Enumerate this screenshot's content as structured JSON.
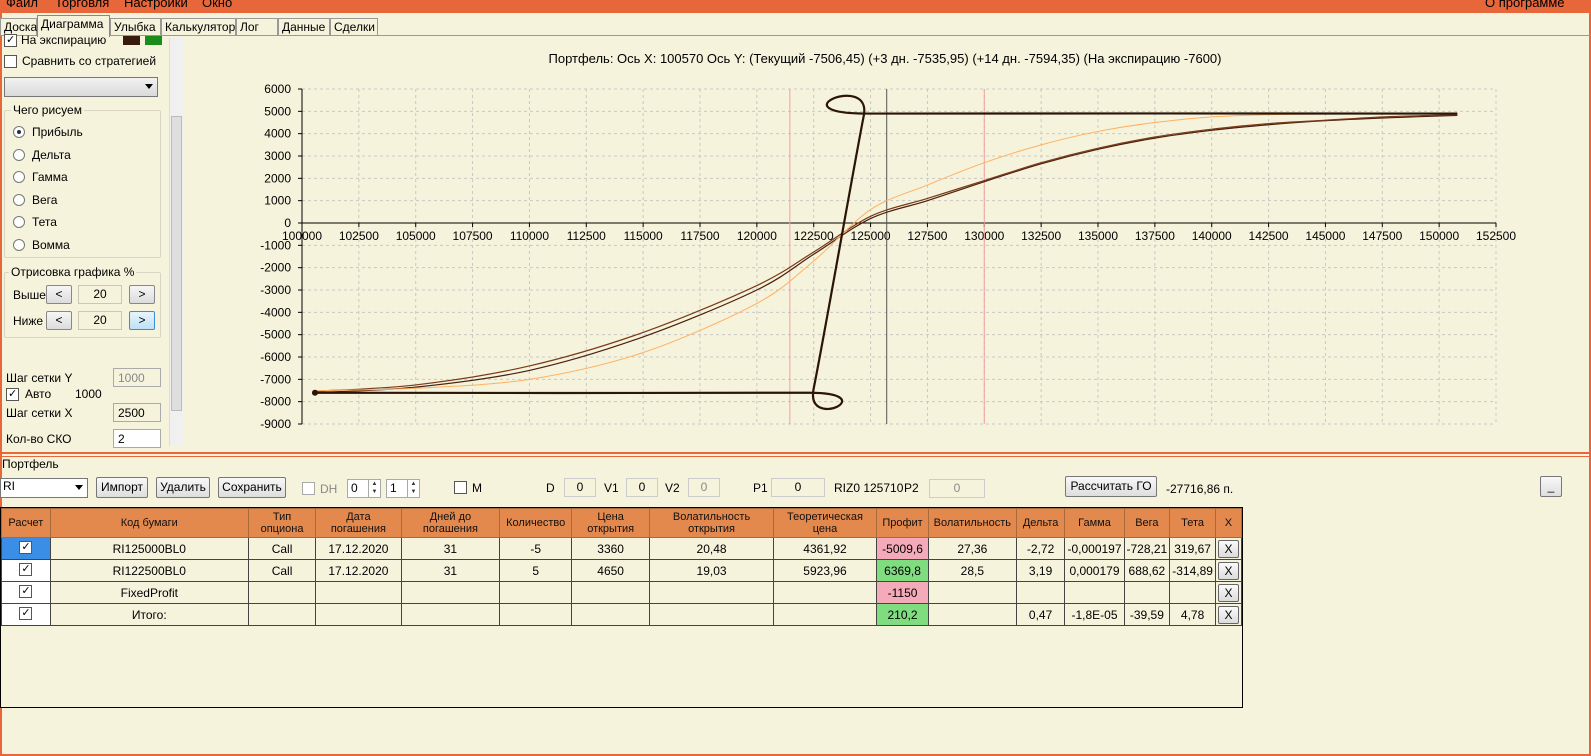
{
  "menu": [
    "Файл",
    "Торговля",
    "Настройки",
    "Окно"
  ],
  "menu_about": "О программе",
  "tabs": [
    "Доска",
    "Диаграмма",
    "Улыбка",
    "Калькулятор",
    "Лог",
    "Данные",
    "Сделки"
  ],
  "active_tab": "Диаграмма",
  "left": {
    "expiry_label": "На экспирацию",
    "expiry_checked": true,
    "expiry_colors": [
      "#3a1a0c",
      "#1a8c1a"
    ],
    "compare_label": "Сравнить со стратегией",
    "compare_checked": false,
    "strategy_value": "",
    "plot_group": "Чего рисуем",
    "plot_options": [
      "Прибыль",
      "Дельта",
      "Гамма",
      "Вега",
      "Тета",
      "Вомма"
    ],
    "plot_selected": 0,
    "render_group": "Отрисовка графика %",
    "above_label": "Выше",
    "above_value": "20",
    "below_label": "Ниже",
    "below_value": "20",
    "prev_glyph": "<",
    "next_glyph": ">",
    "grid_y_label": "Шаг сетки Y",
    "grid_y_value": "1000",
    "auto_label": "Авто",
    "auto_checked": true,
    "auto_value": "1000",
    "grid_x_label": "Шаг сетки X",
    "grid_x_value": "2500",
    "sko_label": "Кол-во СКО",
    "sko_value": "2"
  },
  "chart_header": "Портфель:  Ось X:  100570  Ось Y:   (Текущий -7506,45)  (+3 дн. -7535,95)  (+14 дн. -7594,35)  (На экспирацию -7600)",
  "chart_data": {
    "type": "line",
    "title": "",
    "xlabel": "",
    "ylabel": "",
    "xlim": [
      100000,
      152500
    ],
    "ylim": [
      -9000,
      6000
    ],
    "x_ticks": [
      100000,
      102500,
      105000,
      107500,
      110000,
      112500,
      115000,
      117500,
      120000,
      122500,
      125000,
      127500,
      130000,
      132500,
      135000,
      137500,
      140000,
      142500,
      145000,
      147500,
      150000,
      152500
    ],
    "y_ticks": [
      6000,
      5000,
      4000,
      3000,
      2000,
      1000,
      0,
      -1000,
      -2000,
      -3000,
      -4000,
      -5000,
      -6000,
      -7000,
      -8000,
      -9000
    ],
    "grid": true,
    "vertical_lines": [
      {
        "x": 121450,
        "color": "#f2a0a0"
      },
      {
        "x": 125710,
        "color": "#555555"
      },
      {
        "x": 130000,
        "color": "#f2a0a0"
      }
    ],
    "series": [
      {
        "color": "#2b1408",
        "width": 2.2,
        "points": [
          [
            100570,
            -7600
          ],
          [
            122200,
            -7600
          ],
          [
            122500,
            -7400
          ],
          [
            124700,
            4800
          ],
          [
            124900,
            4900
          ],
          [
            150800,
            4900
          ]
        ]
      },
      {
        "color": "#ffb060",
        "width": 1,
        "points": [
          [
            100570,
            -7506
          ],
          [
            105000,
            -7400
          ],
          [
            110000,
            -7000
          ],
          [
            115000,
            -5800
          ],
          [
            120000,
            -3600
          ],
          [
            122500,
            -1700
          ],
          [
            125000,
            600
          ],
          [
            127500,
            1700
          ],
          [
            130000,
            2700
          ],
          [
            132500,
            3500
          ],
          [
            135000,
            4100
          ],
          [
            137500,
            4500
          ],
          [
            140000,
            4750
          ],
          [
            142500,
            4850
          ],
          [
            145000,
            4880
          ],
          [
            147500,
            4900
          ],
          [
            150800,
            4900
          ]
        ]
      },
      {
        "color": "#7a3a1a",
        "width": 1.2,
        "points": [
          [
            100570,
            -7536
          ],
          [
            105000,
            -7250
          ],
          [
            110000,
            -6400
          ],
          [
            115000,
            -4900
          ],
          [
            120000,
            -2800
          ],
          [
            122500,
            -1300
          ],
          [
            125000,
            300
          ],
          [
            127500,
            1100
          ],
          [
            130000,
            1900
          ],
          [
            132500,
            2700
          ],
          [
            135000,
            3350
          ],
          [
            137500,
            3850
          ],
          [
            140000,
            4200
          ],
          [
            142500,
            4450
          ],
          [
            145000,
            4600
          ],
          [
            147500,
            4750
          ],
          [
            150800,
            4850
          ]
        ]
      },
      {
        "color": "#4a200c",
        "width": 1.2,
        "points": [
          [
            100570,
            -7594
          ],
          [
            105000,
            -7350
          ],
          [
            110000,
            -6600
          ],
          [
            115000,
            -5100
          ],
          [
            120000,
            -3000
          ],
          [
            122500,
            -1400
          ],
          [
            125000,
            200
          ],
          [
            127500,
            1000
          ],
          [
            130000,
            1850
          ],
          [
            132500,
            2650
          ],
          [
            135000,
            3300
          ],
          [
            137500,
            3800
          ],
          [
            140000,
            4150
          ],
          [
            142500,
            4400
          ],
          [
            145000,
            4580
          ],
          [
            147500,
            4700
          ],
          [
            150800,
            4820
          ]
        ]
      }
    ]
  },
  "portfolio": {
    "section_label": "Портфель",
    "symbol": "RI",
    "import_label": "Импорт",
    "delete_label": "Удалить",
    "save_label": "Сохранить",
    "dh_label": "DH",
    "spin1": "0",
    "spin2": "1",
    "m_label": "M",
    "d_label": "D",
    "d_value": "0",
    "v1_label": "V1",
    "v1_value": "0",
    "v2_label": "V2",
    "v2_value": "0",
    "p1_label": "P1",
    "p1_value": "0",
    "riz_text": "RIZ0 125710",
    "p2_label": "P2",
    "p2_value": "0",
    "calc_go_label": "Рассчитать ГО",
    "go_value": "-27716,86 п.",
    "minimize_label": "_"
  },
  "table": {
    "headers": [
      "Расчет",
      "Код бумаги",
      "Тип опциона",
      "Дата погашения",
      "Дней до погашения",
      "Количество",
      "Цена открытия",
      "Волатильность открытия",
      "Теоретическая цена",
      "Профит",
      "Волатильность",
      "Дельта",
      "Гамма",
      "Вега",
      "Тета",
      "X"
    ],
    "rows": [
      {
        "cells": [
          "",
          "RI125000BL0",
          "Call",
          "17.12.2020",
          "31",
          "-5",
          "3360",
          "20,48",
          "4361,92",
          "-5009,6",
          "27,36",
          "-2,72",
          "-0,000197",
          "-728,21",
          "319,67",
          "X"
        ],
        "profit": "pink",
        "selected": true
      },
      {
        "cells": [
          "",
          "RI122500BL0",
          "Call",
          "17.12.2020",
          "31",
          "5",
          "4650",
          "19,03",
          "5923,96",
          "6369,8",
          "28,5",
          "3,19",
          "0,000179",
          "688,62",
          "-314,89",
          "X"
        ],
        "profit": "green",
        "selected": false
      },
      {
        "cells": [
          "",
          "FixedProfit",
          "",
          "",
          "",
          "",
          "",
          "",
          "",
          "-1150",
          "",
          "",
          "",
          "",
          "",
          "X"
        ],
        "profit": "pink",
        "selected": false
      },
      {
        "cells": [
          "",
          "Итого:",
          "",
          "",
          "",
          "",
          "",
          "",
          "",
          "210,2",
          "",
          "0,47",
          "-1,8E-05",
          "-39,59",
          "4,78",
          "X"
        ],
        "profit": "green",
        "selected": false
      }
    ]
  }
}
